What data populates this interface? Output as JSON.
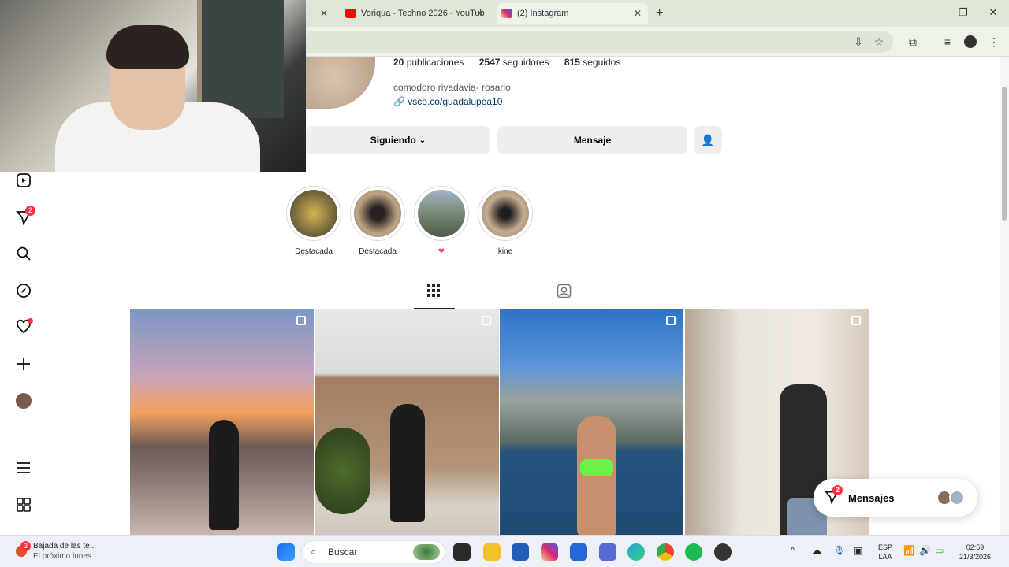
{
  "browser": {
    "tabs": [
      {
        "label": "Voriqua - Techno 2026 - YouTub",
        "icon": "youtube-icon",
        "color": "#ff0000"
      },
      {
        "label": "(2) Instagram",
        "icon": "instagram-icon",
        "color": "#d6249f",
        "active": true
      }
    ],
    "new_tab": "+",
    "window_controls": {
      "minimize": "—",
      "maximize": "❐",
      "close": "✕"
    }
  },
  "sidebar": {
    "notification_badge": "2"
  },
  "profile": {
    "posts_count": "20",
    "posts_label": "publicaciones",
    "followers_count": "2547",
    "followers_label": "seguidores",
    "following_count": "815",
    "following_label": "seguidos",
    "bio": "comodoro rivadavia- rosario",
    "link": "vsco.co/guadalupea10",
    "following_button": "Siguiendo",
    "message_button": "Mensaje"
  },
  "highlights": [
    {
      "label": "Destacada",
      "color": "#a8893c"
    },
    {
      "label": "Destacada",
      "color": "#7a5a45"
    },
    {
      "label": "❤",
      "color": "#5f7a6a"
    },
    {
      "label": "kine",
      "color": "#b79c82"
    }
  ],
  "messages": {
    "label": "Mensajes",
    "badge": "2"
  },
  "taskbar": {
    "notification_title": "Bajada de las te...",
    "notification_sub": "El próximo lunes",
    "notification_badge": "3",
    "search_placeholder": "Buscar",
    "language_line1": "ESP",
    "language_line2": "LAA",
    "time": "02:59",
    "date": "21/3/2026"
  }
}
